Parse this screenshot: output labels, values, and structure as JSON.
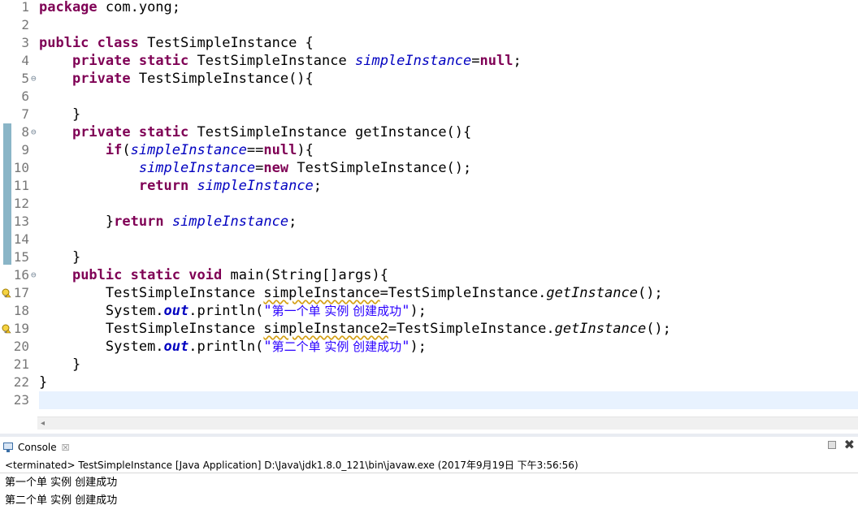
{
  "editor": {
    "line_numbers": [
      "1",
      "2",
      "3",
      "4",
      "5",
      "6",
      "7",
      "8",
      "9",
      "10",
      "11",
      "12",
      "13",
      "14",
      "15",
      "16",
      "17",
      "18",
      "19",
      "20",
      "21",
      "22",
      "23"
    ],
    "fold_marker": "⊖",
    "tokens": {
      "package": "package",
      "pkg_name": " com.yong;",
      "public": "public",
      "class": "class",
      "private": "private",
      "static": "static",
      "void": "void",
      "null": "null",
      "new": "new",
      "if": "if",
      "return": "return",
      "class_decl": " TestSimpleInstance {",
      "type_sp": " TestSimpleInstance ",
      "field": "simpleInstance",
      "assign_null": "=",
      "semicolon": ";",
      "ctor": " TestSimpleInstance(){",
      "close_brace": "}",
      "get_instance_decl": " TestSimpleInstance getInstance(){",
      "open_paren": "(",
      "eqeq": "==",
      "close_paren_brace": "){",
      "eq": "=",
      "new_call": " TestSimpleInstance();",
      "space": " ",
      "main_decl": " main(String[]args){",
      "local_type": "TestSimpleInstance ",
      "local1": "simpleInstance",
      "local2": "simpleInstance2",
      "assign_call_prefix": "=TestSimpleInstance.",
      "get_instance": "getInstance",
      "call_suffix": "();",
      "system": "System.",
      "out": "out",
      "println_open": ".println(",
      "str1_q1": "\"",
      "str1": "第一个单 实例 创建成功",
      "str2": "第二个单 实例 创建成功",
      "str_q2": "\"",
      "println_close": ");",
      "main_close": "}",
      "class_close": "}"
    }
  },
  "console": {
    "tab_label": "Console",
    "tab_close": "☒",
    "header": "<terminated> TestSimpleInstance [Java Application] D:\\Java\\jdk1.8.0_121\\bin\\javaw.exe (2017年9月19日 下午3:56:56)",
    "output": [
      "第一个单 实例 创建成功",
      "第二个单 实例 创建成功"
    ],
    "max_label": "✖"
  },
  "colors": {
    "keyword": "#7f0055",
    "field": "#0000c0",
    "string": "#2a00ff",
    "current_line": "#e8f2fe"
  },
  "icons": {
    "fold": "fold-collapse-icon",
    "warning": "warning-lightbulb-icon",
    "console": "console-icon"
  }
}
